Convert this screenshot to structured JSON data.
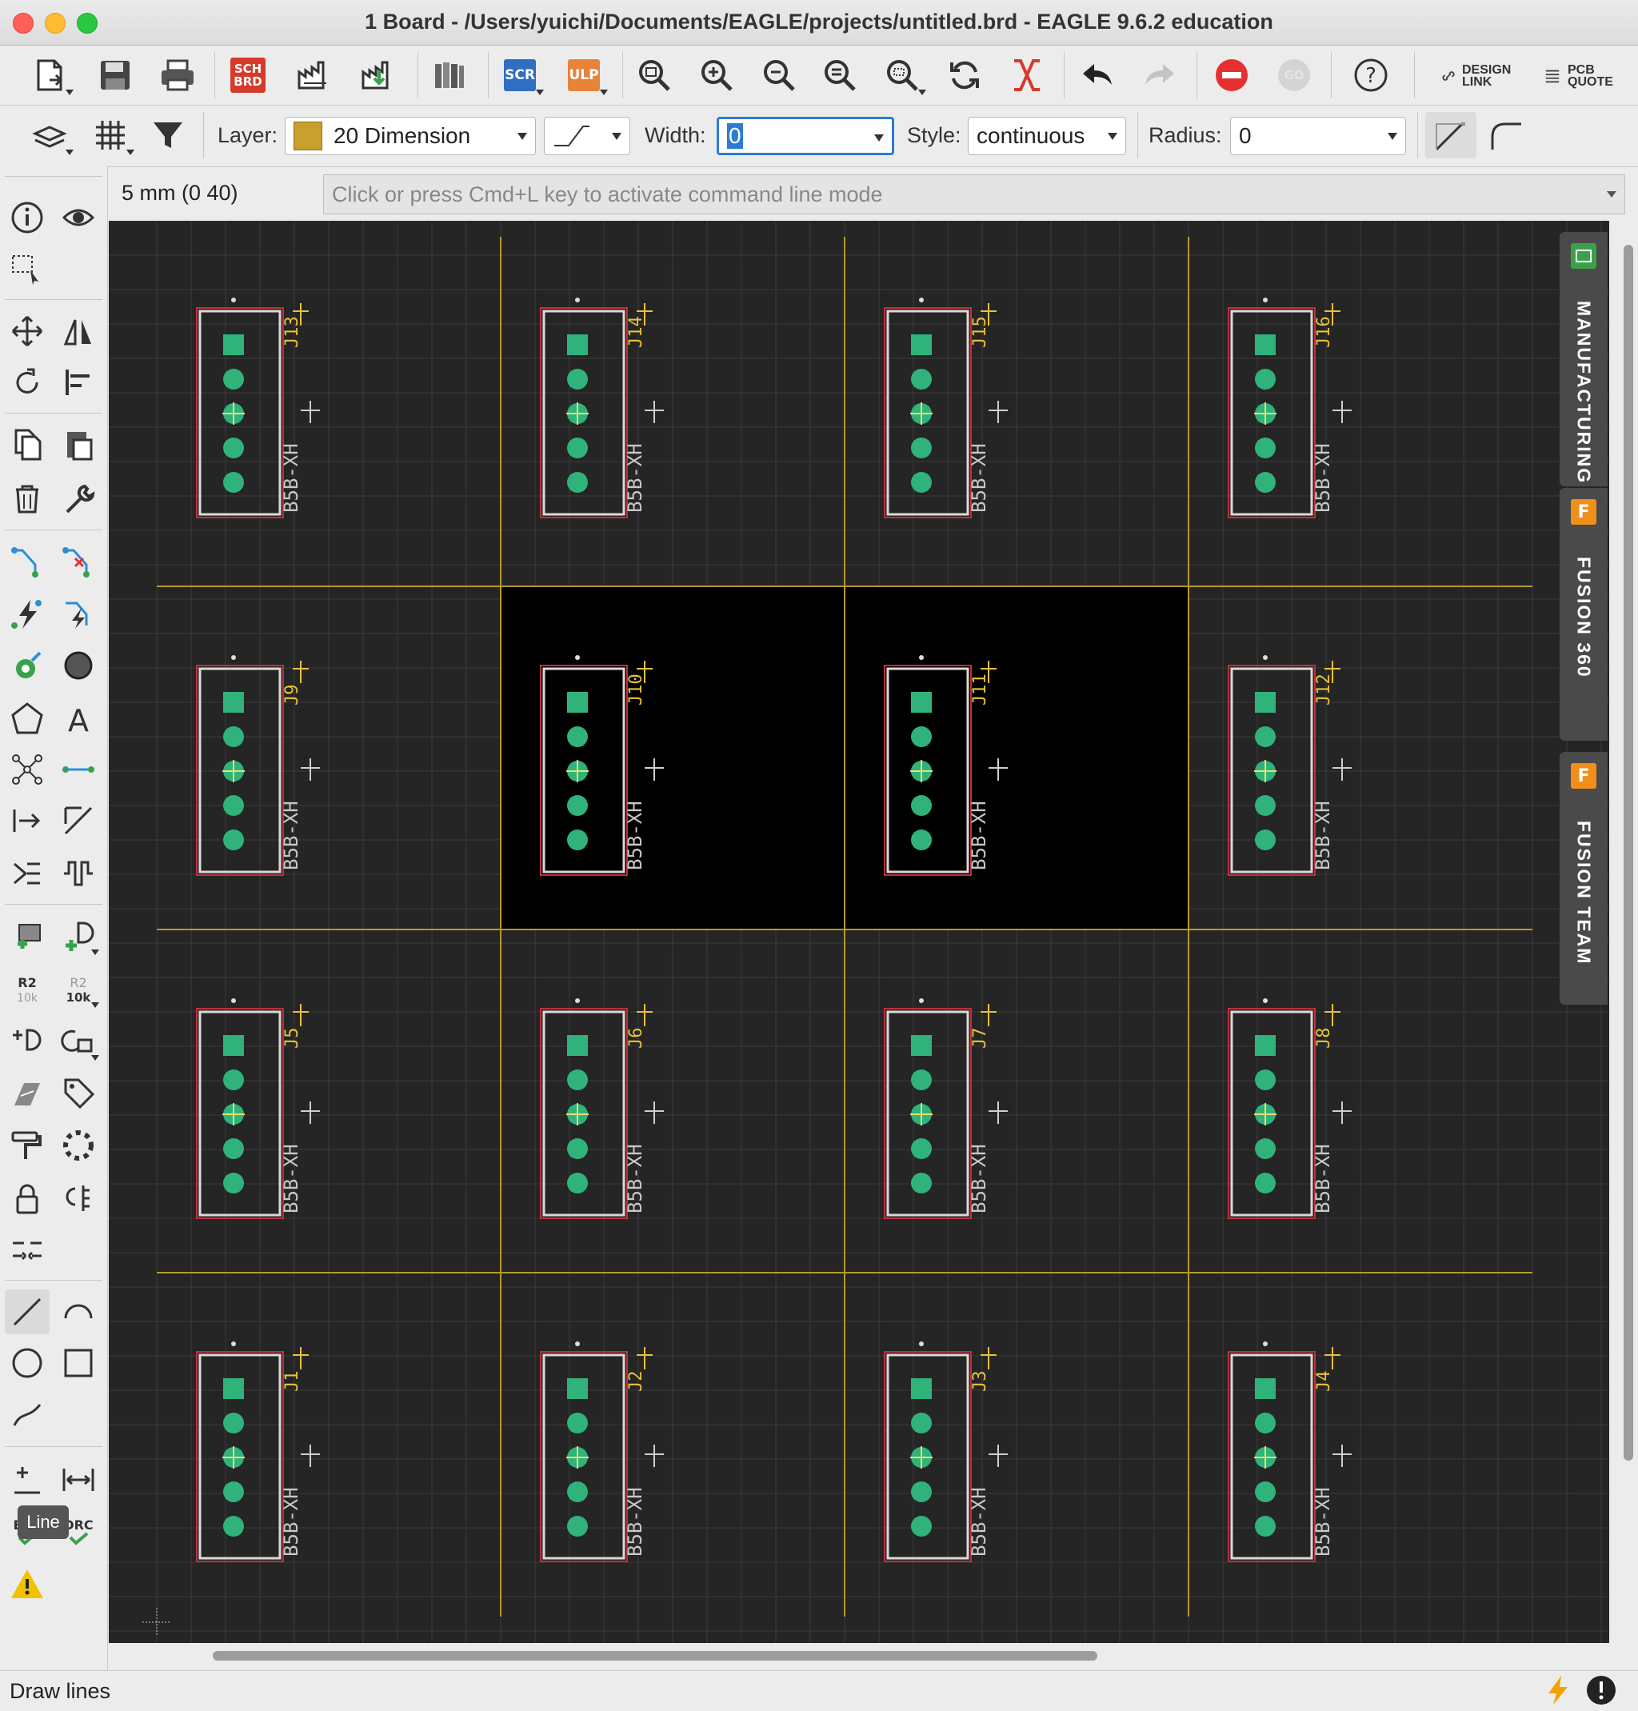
{
  "window": {
    "title": "1 Board - /Users/yuichi/Documents/EAGLE/projects/untitled.brd - EAGLE 9.6.2 education"
  },
  "toolbar": {
    "buttons": [
      {
        "name": "open-icon"
      },
      {
        "name": "save-icon"
      },
      {
        "name": "print-icon"
      },
      {
        "name": "sch-brd-icon",
        "text": "SCH\nBRD"
      },
      {
        "name": "cam-processor-icon"
      },
      {
        "name": "export-icon"
      },
      {
        "name": "library-icon"
      },
      {
        "name": "script-icon",
        "text": "SCR"
      },
      {
        "name": "ulp-icon",
        "text": "ULP"
      },
      {
        "name": "zoom-fit-icon"
      },
      {
        "name": "zoom-in-icon"
      },
      {
        "name": "zoom-out-icon"
      },
      {
        "name": "zoom-redraw-icon"
      },
      {
        "name": "zoom-select-icon"
      },
      {
        "name": "refresh-icon"
      },
      {
        "name": "ratsnest-icon"
      },
      {
        "name": "undo-icon"
      },
      {
        "name": "redo-icon"
      },
      {
        "name": "stop-icon"
      },
      {
        "name": "go-icon",
        "text": "GO"
      },
      {
        "name": "help-icon"
      }
    ],
    "design_link_label": "DESIGN\nLINK",
    "pcb_quote_label": "PCB\nQUOTE"
  },
  "params": {
    "layer_label": "Layer:",
    "layer_value": "20 Dimension",
    "layer_color": "#c8a030",
    "width_label": "Width:",
    "width_value": "0",
    "style_label": "Style:",
    "style_value": "continuous",
    "radius_label": "Radius:",
    "radius_value": "0"
  },
  "command": {
    "coordinate": "5 mm (0 40)",
    "placeholder": "Click or press Cmd+L key to activate command line mode"
  },
  "tooltip": "Line",
  "right_tabs": [
    {
      "label": "MANUFACTURING",
      "icon": "manufacturing-icon",
      "icon_color": "#3aa14a"
    },
    {
      "label": "FUSION 360",
      "icon": "fusion-360-icon",
      "icon_color": "#f08f1a"
    },
    {
      "label": "FUSION TEAM",
      "icon": "fusion-team-icon",
      "icon_color": "#f08f1a"
    }
  ],
  "board": {
    "package": "B5B-XH",
    "rows": [
      [
        "J13",
        "J14",
        "J15",
        "J16"
      ],
      [
        "J9",
        "J10",
        "J11",
        "J12"
      ],
      [
        "J5",
        "J6",
        "J7",
        "J8"
      ],
      [
        "J1",
        "J2",
        "J3",
        "J4"
      ]
    ],
    "highlighted": [
      "J10",
      "J11"
    ],
    "pad_color": "#2fb37a",
    "outline_color": "#d9d9d9",
    "dimension_color": "#b59a2a"
  },
  "status": {
    "text": "Draw lines"
  }
}
